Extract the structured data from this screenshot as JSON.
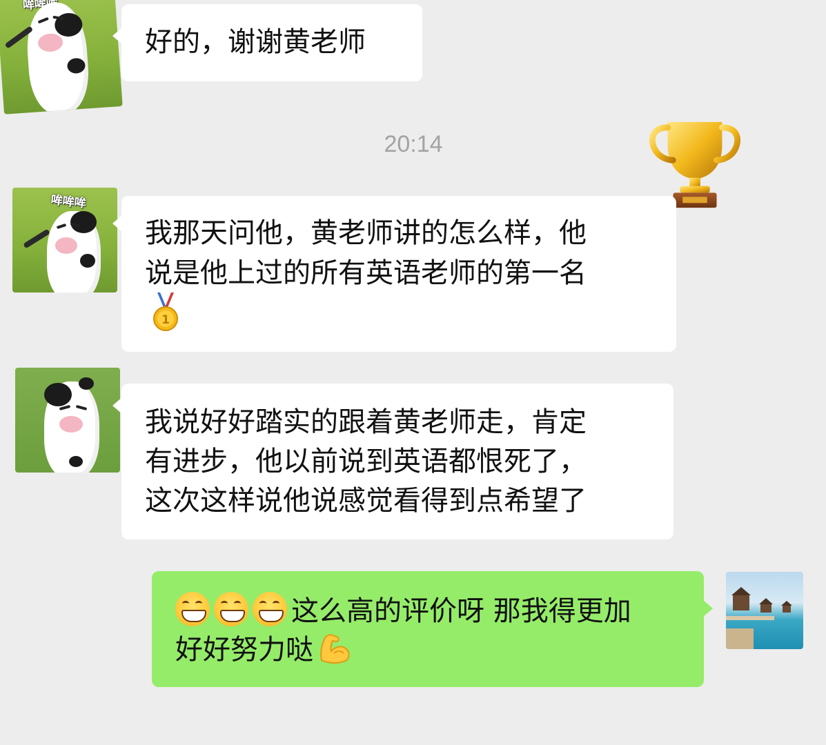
{
  "messages": [
    {
      "sender": "other",
      "text": "好的，谢谢黄老师"
    },
    {
      "sender": "other",
      "lines": [
        "我那天问他，黄老师讲的怎么样，他",
        "说是他上过的所有英语老师的第一名"
      ],
      "trailing_emoji": "medal-icon"
    },
    {
      "sender": "other",
      "lines": [
        "我说好好踏实的跟着黄老师走，肯定",
        "有进步，他以前说到英语都恨死了，",
        "这次这样说他说感觉看得到点希望了"
      ]
    },
    {
      "sender": "self",
      "lines": [
        "这么高的评价呀 那我得更加",
        "好好努力哒"
      ],
      "leading_emojis": [
        "grin-icon",
        "grin-icon",
        "grin-icon"
      ],
      "trailing_emoji": "flexed-biceps-icon"
    }
  ],
  "timestamp": "20:14",
  "sticker_text": {
    "avatar1": "哞哞哞",
    "avatar2": "哞哞哞"
  },
  "decorations": {
    "trophy": "trophy-icon"
  },
  "colors": {
    "background": "#ededed",
    "self_bubble": "#95ec69",
    "other_bubble": "#ffffff",
    "timestamp": "#a3a3a3"
  }
}
